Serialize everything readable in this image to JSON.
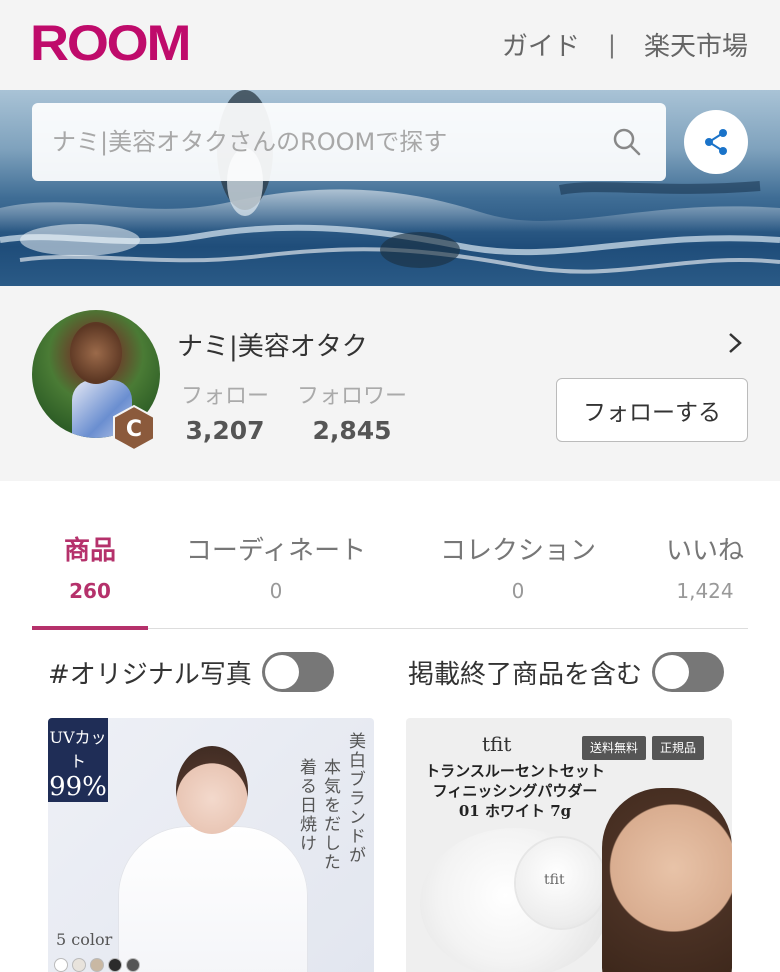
{
  "header": {
    "logo": "ROOM",
    "links": [
      "ガイド",
      "楽天市場"
    ],
    "separator": "|"
  },
  "search": {
    "placeholder": "ナミ|美容オタクさんのROOMで探す"
  },
  "profile": {
    "username": "ナミ|美容オタク",
    "follow_label": "フォロー",
    "follow_count": "3,207",
    "follower_label": "フォロワー",
    "follower_count": "2,845",
    "follow_button": "フォローする",
    "badge_letter": "C"
  },
  "tabs": [
    {
      "label": "商品",
      "count": "260",
      "active": true
    },
    {
      "label": "コーディネート",
      "count": "0",
      "active": false
    },
    {
      "label": "コレクション",
      "count": "0",
      "active": false
    },
    {
      "label": "いいね",
      "count": "1,424",
      "active": false
    }
  ],
  "toggles": {
    "original_photo": {
      "label": "#オリジナル写真",
      "on": false
    },
    "include_ended": {
      "label": "掲載終了商品を含む",
      "on": false
    }
  },
  "products": [
    {
      "uv_top": "UVカット",
      "uv_value": "99%",
      "vertical_text": [
        "美白ブランドが",
        "本気をだした",
        "着る日焼け"
      ],
      "colors_label": "5 color",
      "swatch_colors": [
        "#ffffff",
        "#e8e3dc",
        "#c9b8a3",
        "#2b2b2b",
        "#555555"
      ]
    },
    {
      "brand": "tfit",
      "tags": [
        "送料無料",
        "正規品"
      ],
      "name_lines": [
        "トランスルーセントセット",
        "フィニッシングパウダー",
        "01 ホワイト 7g"
      ],
      "jar_brand": "tfit"
    }
  ],
  "colors": {
    "brand": "#bf0b6b",
    "active_tab": "#b5316b"
  }
}
